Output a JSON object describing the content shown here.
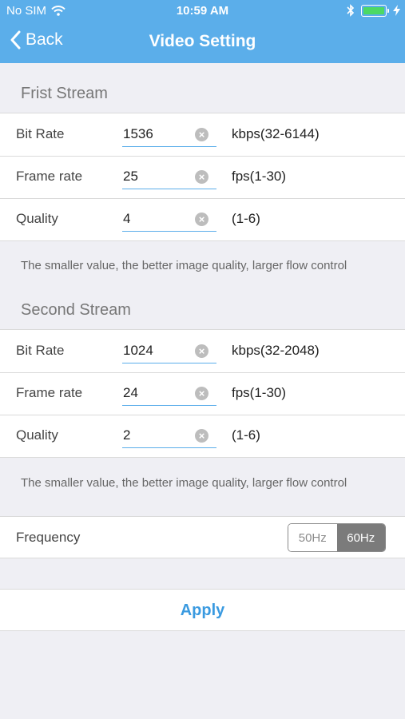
{
  "status_bar": {
    "carrier": "No SIM",
    "time": "10:59 AM",
    "battery_color": "#4cd964"
  },
  "nav": {
    "back_label": "Back",
    "title": "Video Setting",
    "color": "#5baeea"
  },
  "first_stream": {
    "title": "Frist Stream",
    "bit_rate": {
      "label": "Bit Rate",
      "value": "1536",
      "range": "kbps(32-6144)"
    },
    "frame_rate": {
      "label": "Frame rate",
      "value": "25",
      "range": "fps(1-30)"
    },
    "quality": {
      "label": "Quality",
      "value": "4",
      "range": "(1-6)"
    },
    "note": "The smaller value, the better image quality, larger flow control"
  },
  "second_stream": {
    "title": "Second Stream",
    "bit_rate": {
      "label": "Bit Rate",
      "value": "1024",
      "range": "kbps(32-2048)"
    },
    "frame_rate": {
      "label": "Frame rate",
      "value": "24",
      "range": "fps(1-30)"
    },
    "quality": {
      "label": "Quality",
      "value": "2",
      "range": "(1-6)"
    },
    "note": "The smaller value, the better image quality, larger flow control"
  },
  "frequency": {
    "label": "Frequency",
    "options": [
      "50Hz",
      "60Hz"
    ],
    "selected": "60Hz"
  },
  "apply_label": "Apply"
}
